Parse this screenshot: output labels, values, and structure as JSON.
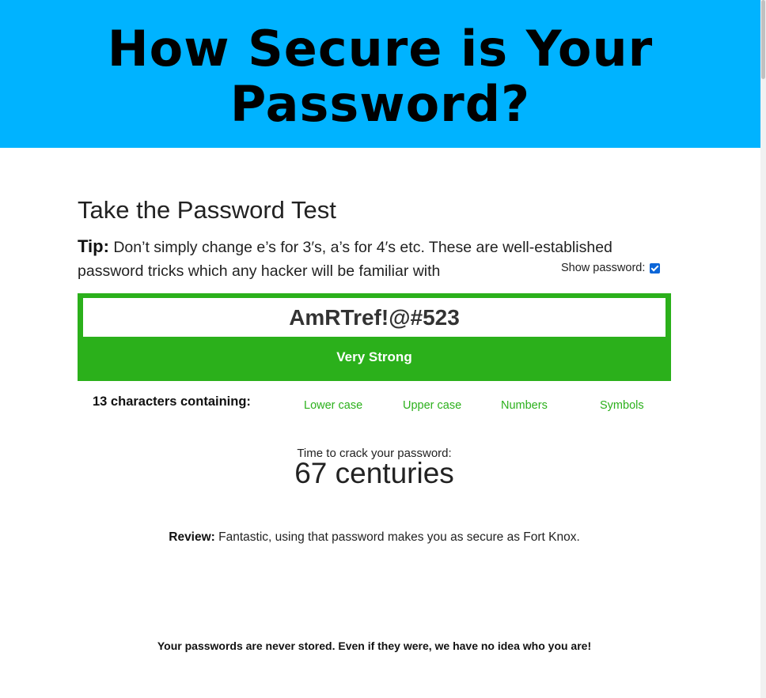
{
  "header": {
    "title": "How Secure is Your Password?"
  },
  "test": {
    "title": "Take the Password Test",
    "tip_label": "Tip:",
    "tip_text": " Don’t simply change e’s for 3′s, a’s for 4′s etc. These are well-established password tricks which any hacker will be familiar with",
    "show_password_label": "Show password:",
    "show_password_checked": true
  },
  "password": {
    "value": "AmRTref!@#523",
    "strength": "Very Strong",
    "strength_color": "#2bb01b"
  },
  "analysis": {
    "chars_summary": "13 characters containing:",
    "criteria": [
      "Lower case",
      "Upper case",
      "Numbers",
      "Symbols"
    ]
  },
  "crack": {
    "label": "Time to crack your password:",
    "value": "67 centuries"
  },
  "review": {
    "label": "Review:",
    "text": " Fantastic, using that password makes you as secure as Fort Knox."
  },
  "footer": {
    "text": "Your passwords are never stored. Even if they were, we have no idea who you are!"
  },
  "colors": {
    "header_bg": "#00b3ff",
    "accent_green": "#2bb01b"
  }
}
